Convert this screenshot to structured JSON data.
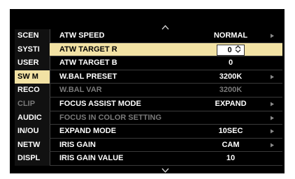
{
  "sidebar": {
    "items": [
      {
        "label": "SCEN",
        "state": "normal"
      },
      {
        "label": "SYSTI",
        "state": "normal"
      },
      {
        "label": "USER",
        "state": "normal"
      },
      {
        "label": "SW M",
        "state": "selected"
      },
      {
        "label": "RECO",
        "state": "normal"
      },
      {
        "label": "CLIP",
        "state": "dim"
      },
      {
        "label": "AUDIC",
        "state": "normal"
      },
      {
        "label": "IN/OU",
        "state": "normal"
      },
      {
        "label": "NETW",
        "state": "normal"
      },
      {
        "label": "DISPL",
        "state": "normal"
      }
    ]
  },
  "menu": {
    "items": [
      {
        "label": "ATW SPEED",
        "value": "NORMAL",
        "arrow": true,
        "state": "normal"
      },
      {
        "label": "ATW TARGET R",
        "value": "0",
        "arrow": false,
        "state": "selected",
        "editing": true
      },
      {
        "label": "ATW TARGET B",
        "value": "0",
        "arrow": false,
        "state": "normal"
      },
      {
        "label": "W.BAL PRESET",
        "value": "3200K",
        "arrow": true,
        "state": "normal"
      },
      {
        "label": "W.BAL VAR",
        "value": "3200K",
        "arrow": false,
        "state": "dim"
      },
      {
        "label": "FOCUS ASSIST MODE",
        "value": "EXPAND",
        "arrow": true,
        "state": "normal"
      },
      {
        "label": "FOCUS IN COLOR SETTING",
        "value": "",
        "arrow": true,
        "state": "dim"
      },
      {
        "label": "EXPAND MODE",
        "value": "10SEC",
        "arrow": true,
        "state": "normal"
      },
      {
        "label": "IRIS GAIN",
        "value": "CAM",
        "arrow": true,
        "state": "normal"
      },
      {
        "label": "IRIS GAIN VALUE",
        "value": "10",
        "arrow": false,
        "state": "normal"
      }
    ]
  },
  "icons": {
    "scroll_up": "chevron-up-icon",
    "scroll_down": "chevron-down-icon",
    "submenu": "triangle-right-icon",
    "spin": "up-down-spin-icon"
  },
  "colors": {
    "background": "#000000",
    "selection": "#f2e2a4",
    "disabled_text": "#7a7a7a"
  }
}
